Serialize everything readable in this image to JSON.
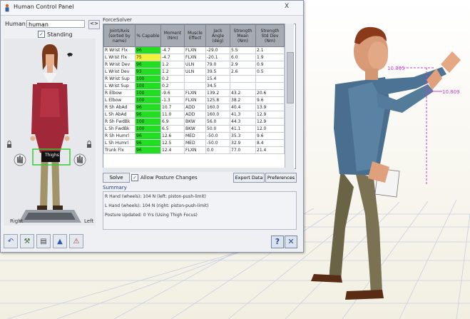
{
  "window": {
    "title": "Human Control Panel",
    "close_glyph": "X"
  },
  "human": {
    "label": "Human:",
    "value": "human",
    "button": "<>"
  },
  "standing": {
    "label": "Standing",
    "checked": true
  },
  "figure": {
    "tag": "Thighs",
    "left_label": "Right",
    "right_label": "Left"
  },
  "forcesolver": {
    "label": "ForceSolver"
  },
  "table": {
    "headers": [
      "Joint/Axis (sorted by name)",
      "% Capable",
      "Moment (Nm)",
      "Muscle Effect",
      "Jack Angle (deg)",
      "Strength Mean (Nm)",
      "Strength Std Dev (Nm)"
    ],
    "rows": [
      [
        "R Wrist Flx",
        "96",
        "-4.7",
        "FLXN",
        "-29.0",
        "5.5",
        "2.1"
      ],
      [
        "L Wrist Flx",
        "75",
        "-4.7",
        "FLXN",
        "-20.1",
        "6.0",
        "1.9"
      ],
      [
        "R Wrist Dev",
        "96",
        "1.2",
        "ULN",
        "79.0",
        "2.9",
        "0.9"
      ],
      [
        "L Wrist Dev",
        "93",
        "1.2",
        "ULN",
        "39.5",
        "2.6",
        "0.5"
      ],
      [
        "R Wrist Sup",
        "100",
        "0.2",
        "",
        "15.4",
        "",
        ""
      ],
      [
        "L Wrist Sup",
        "100",
        "0.2",
        "",
        "34.5",
        "",
        ""
      ],
      [
        "R Elbow",
        "100",
        "-9.6",
        "FLXN",
        "139.2",
        "43.2",
        "20.6"
      ],
      [
        "L Elbow",
        "100",
        "-1.3",
        "FLXN",
        "125.8",
        "38.2",
        "9.6"
      ],
      [
        "R Sh AbAd",
        "96",
        "10.7",
        "ADD",
        "160.0",
        "40.4",
        "13.9"
      ],
      [
        "L Sh AbAd",
        "96",
        "11.0",
        "ADD",
        "160.0",
        "41.3",
        "12.9"
      ],
      [
        "R Sh FwdBk",
        "100",
        "6.9",
        "BKW",
        "56.0",
        "44.3",
        "12.9"
      ],
      [
        "L Sh FwdBk",
        "100",
        "6.5",
        "BKW",
        "50.0",
        "41.1",
        "12.0"
      ],
      [
        "R Sh Humrl",
        "96",
        "12.6",
        "MED",
        "-50.0",
        "35.3",
        "9.6"
      ],
      [
        "L Sh Humrl",
        "96",
        "12.5",
        "MED",
        "-50.0",
        "32.9",
        "8.4"
      ],
      [
        "Trunk Flx",
        "96",
        "12.4",
        "FLXN",
        "0.0",
        "77.0",
        "21.4"
      ]
    ]
  },
  "controls": {
    "solve": "Solve",
    "allow_posture": "Allow Posture Changes",
    "export": "Export Data",
    "preferences": "Preferences"
  },
  "summary": {
    "label": "Summary",
    "lines": [
      "R Hand (wheels): 104 N (left: piston-push-limit)",
      "L Hand (wheels): 104 N (right: piston-push-limit)",
      "Posture Updated: 0 Yrs (Using Thigh Focus)"
    ]
  },
  "overlay": {
    "value1": "10.805",
    "value2": "10.809"
  },
  "colors": {
    "green": "#22dd22",
    "yellow": "#f2f23a",
    "header": "#a6aab2",
    "panel": "#eef0f4"
  }
}
